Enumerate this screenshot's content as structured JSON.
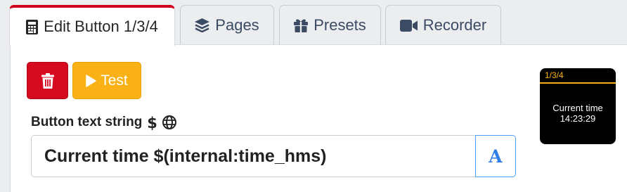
{
  "tabs": [
    {
      "label": "Edit Button 1/3/4",
      "icon": "calculator-icon",
      "active": true
    },
    {
      "label": "Pages",
      "icon": "layers-icon",
      "active": false
    },
    {
      "label": "Presets",
      "icon": "gift-icon",
      "active": false
    },
    {
      "label": "Recorder",
      "icon": "video-camera-icon",
      "active": false
    }
  ],
  "toolbar": {
    "delete_icon": "trash-icon",
    "test_label": "Test",
    "test_icon": "play-icon"
  },
  "field": {
    "label": "Button text string",
    "label_icons": [
      "dollar-sign-icon",
      "globe-icon"
    ],
    "value": "Current time $(internal:time_hms)",
    "font_button_label": "A"
  },
  "preview": {
    "bank_label": "1/3/4",
    "text": "Current time\n14:23:29"
  },
  "colors": {
    "active_tab_accent": "#d0021b",
    "delete_button": "#d50a1e",
    "test_button": "#f9b115",
    "font_button_border": "#4c9dff",
    "preview_header": "#f9b115"
  }
}
